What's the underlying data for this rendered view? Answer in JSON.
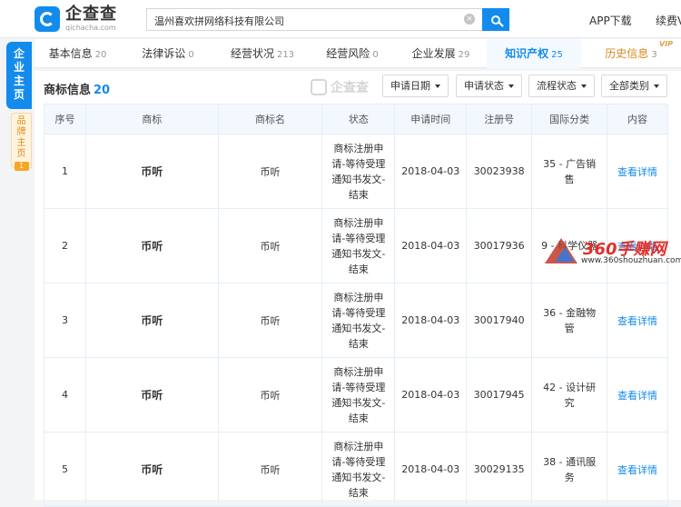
{
  "header": {
    "logo_cn": "企查查",
    "logo_en": "qichacha.com",
    "search_value": "温州喜欢拼网络科技有限公司",
    "app_download": "APP下载",
    "renew": "续费V"
  },
  "side": {
    "main_label": "企业主页",
    "brand_label": "品牌主页",
    "brand_badge": "1"
  },
  "tabs": [
    {
      "label": "基本信息",
      "count": "20"
    },
    {
      "label": "法律诉讼",
      "count": "0"
    },
    {
      "label": "经营状况",
      "count": "213"
    },
    {
      "label": "经营风险",
      "count": "0"
    },
    {
      "label": "企业发展",
      "count": "29"
    },
    {
      "label": "知识产权",
      "count": "25"
    },
    {
      "label": "历史信息",
      "count": "3"
    }
  ],
  "vip_tag": "VIP",
  "section": {
    "title": "商标信息",
    "count": "20",
    "watermark": "企查查",
    "filters": [
      "申请日期",
      "申请状态",
      "流程状态",
      "全部类别"
    ]
  },
  "table": {
    "columns": [
      "序号",
      "商标",
      "商标名",
      "状态",
      "申请时间",
      "注册号",
      "国际分类",
      "内容"
    ],
    "rows": [
      {
        "no": "1",
        "mark": "币听",
        "name": "币听",
        "status": "商标注册申请-等待受理通知书发文-结束",
        "date": "2018-04-03",
        "reg": "30023938",
        "cls": "35 - 广告销售",
        "action": "查看详情"
      },
      {
        "no": "2",
        "mark": "币听",
        "name": "币听",
        "status": "商标注册申请-等待受理通知书发文-结束",
        "date": "2018-04-03",
        "reg": "30017936",
        "cls": "9 - 科学仪器",
        "action": "查看详情"
      },
      {
        "no": "3",
        "mark": "币听",
        "name": "币听",
        "status": "商标注册申请-等待受理通知书发文-结束",
        "date": "2018-04-03",
        "reg": "30017940",
        "cls": "36 - 金融物管",
        "action": "查看详情"
      },
      {
        "no": "4",
        "mark": "币听",
        "name": "币听",
        "status": "商标注册申请-等待受理通知书发文-结束",
        "date": "2018-04-03",
        "reg": "30017945",
        "cls": "42 - 设计研究",
        "action": "查看详情"
      },
      {
        "no": "5",
        "mark": "币听",
        "name": "币听",
        "status": "商标注册申请-等待受理通知书发文-结束",
        "date": "2018-04-03",
        "reg": "30029135",
        "cls": "38 - 通讯服务",
        "action": "查看详情"
      }
    ]
  },
  "site_watermark": {
    "big": "360手赚网",
    "small": "www.360shouzhuan.com"
  }
}
